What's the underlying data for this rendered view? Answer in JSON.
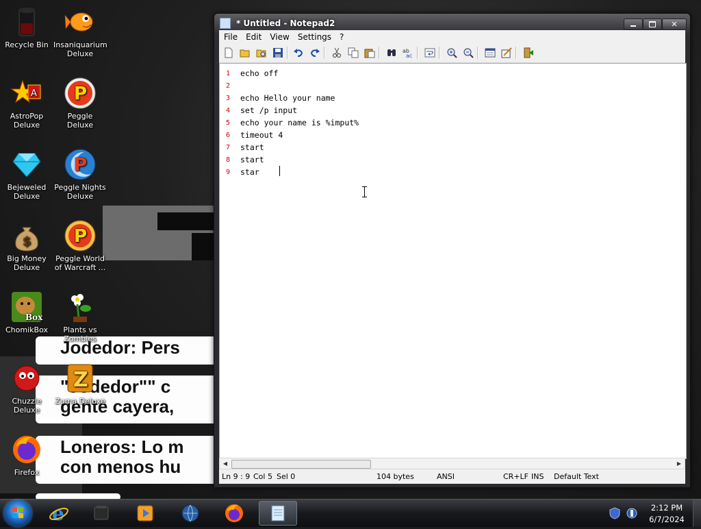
{
  "desktop": {
    "icons": [
      {
        "label": "Recycle Bin",
        "icon": "recycle-bin-icon"
      },
      {
        "label": "Insaniquarium Deluxe",
        "icon": "fish-icon"
      },
      {
        "label": "AstroPop Deluxe",
        "icon": "astropop-icon"
      },
      {
        "label": "Peggle Deluxe",
        "icon": "peggle-icon"
      },
      {
        "label": "Bejeweled Deluxe",
        "icon": "gem-icon"
      },
      {
        "label": "Peggle Nights Deluxe",
        "icon": "peggle-nights-icon"
      },
      {
        "label": "Big Money Deluxe",
        "icon": "money-bag-icon"
      },
      {
        "label": "Peggle World of Warcraft ...",
        "icon": "peggle-wow-icon"
      },
      {
        "label": "ChomikBox",
        "icon": "chomikbox-icon"
      },
      {
        "label": "Plants vs Zombies",
        "icon": "flower-icon"
      },
      {
        "label": "Chuzzle Deluxe",
        "icon": "chuzzle-icon"
      },
      {
        "label": "Zuma Deluxe",
        "icon": "zuma-icon"
      },
      {
        "label": "Firefox",
        "icon": "firefox-icon"
      }
    ]
  },
  "wallpaper_captions": [
    "Jodedor: Pers",
    "\"Jodedor\"\" c\ngente cayera,",
    "Loneros: Lo m\ncon menos hu"
  ],
  "window": {
    "title": "* Untitled - Notepad2",
    "controls": {
      "minimize": "",
      "maximize": "",
      "close": "✕"
    }
  },
  "menu": [
    "File",
    "Edit",
    "View",
    "Settings",
    "?"
  ],
  "toolbar": {
    "buttons": [
      "new-icon",
      "open-icon",
      "browse-icon",
      "save-icon",
      "undo-icon",
      "redo-icon",
      "cut-icon",
      "copy-icon",
      "paste-icon",
      "find-icon",
      "replace-icon",
      "word-wrap-icon",
      "zoom-in-icon",
      "zoom-out-icon",
      "scheme-icon",
      "customize-scheme-icon",
      "exit-icon"
    ]
  },
  "editor": {
    "lines": [
      {
        "number": "1",
        "text": "echo off"
      },
      {
        "number": "2",
        "text": ""
      },
      {
        "number": "3",
        "text": "echo Hello your name"
      },
      {
        "number": "4",
        "text": "set /p input"
      },
      {
        "number": "5",
        "text": "echo your name is %imput%"
      },
      {
        "number": "6",
        "text": "timeout 4"
      },
      {
        "number": "7",
        "text": "start"
      },
      {
        "number": "8",
        "text": "start"
      },
      {
        "number": "9",
        "text": "star"
      }
    ]
  },
  "statusbar": {
    "position": "Ln 9 : 9",
    "column": "Col 5",
    "selection": "Sel 0",
    "size": "104 bytes",
    "encoding": "ANSI",
    "line_endings": "CR+LF",
    "insert_mode": "INS",
    "scheme": "Default Text"
  },
  "taskbar": {
    "clock_time": "2:12 PM",
    "clock_date": "6/7/2024"
  }
}
